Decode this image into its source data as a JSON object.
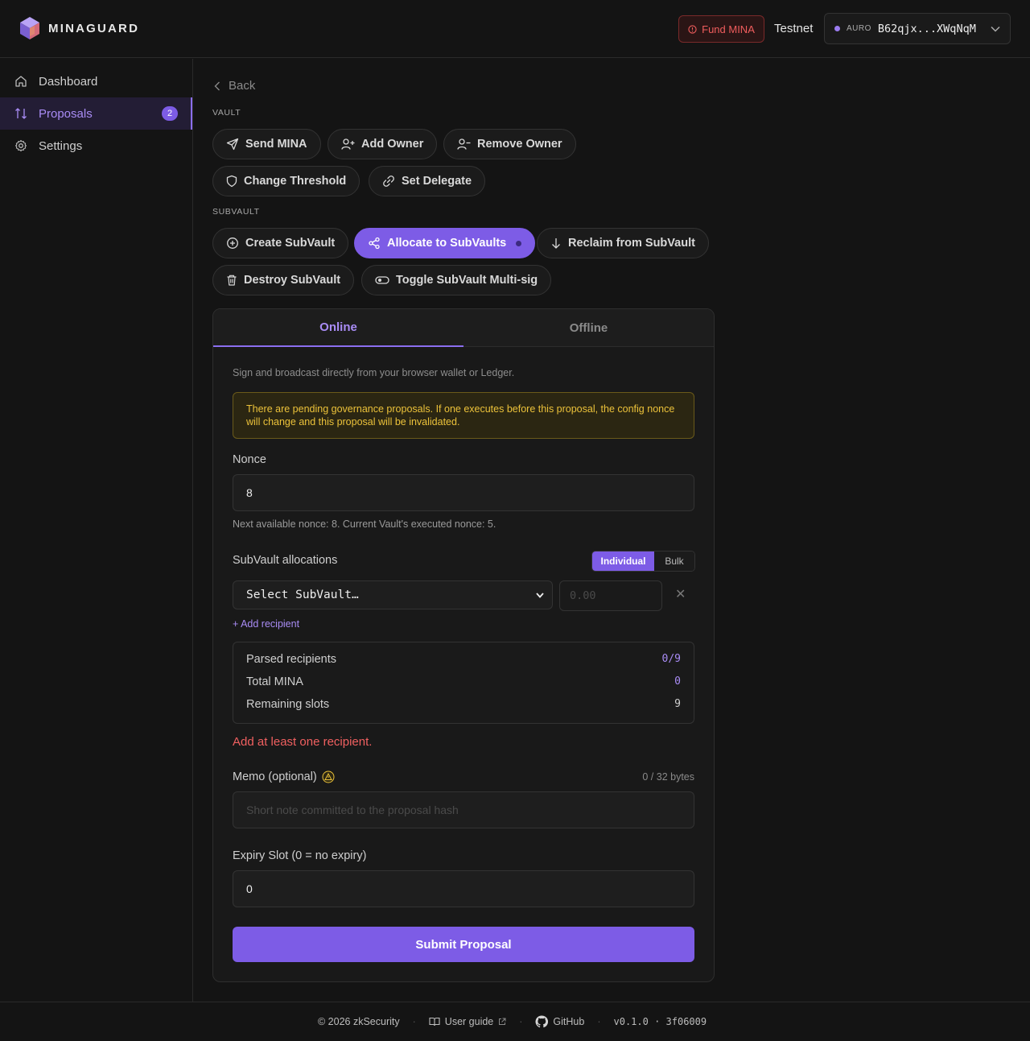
{
  "app": {
    "name": "MINAGUARD"
  },
  "header": {
    "fund_label": "Fund MINA",
    "network": "Testnet",
    "wallet_label": "AURO",
    "wallet_address": "B62qjx...XWqNqM"
  },
  "sidebar": {
    "items": [
      {
        "label": "Dashboard"
      },
      {
        "label": "Proposals",
        "badge": "2"
      },
      {
        "label": "Settings"
      }
    ]
  },
  "main": {
    "back_label": "Back",
    "vault_section": "VAULT",
    "vault_actions": [
      "Send MINA",
      "Add Owner",
      "Remove Owner",
      "Change Threshold",
      "Set Delegate"
    ],
    "subvault_section": "SUBVAULT",
    "subvault_actions": [
      "Create SubVault",
      "Allocate to SubVaults",
      "Reclaim from SubVault",
      "Destroy SubVault",
      "Toggle SubVault Multi-sig"
    ],
    "tabs": [
      "Online",
      "Offline"
    ],
    "description": "Sign and broadcast directly from your browser wallet or Ledger.",
    "warning_line1": "There are pending governance proposals. If one executes before this proposal, the config nonce",
    "warning_line2": "will change and this proposal will be invalidated.",
    "nonce_label": "Nonce",
    "nonce_value": "8",
    "nonce_hint": "Next available nonce: 8. Current Vault's executed nonce: 5.",
    "allocations_label": "SubVault allocations",
    "mode_options": [
      "Individual",
      "Bulk"
    ],
    "subvault_select": "Select SubVault…",
    "amount_placeholder": "0.00",
    "add_recipient": "+ Add recipient",
    "summary": {
      "parsed_label": "Parsed recipients",
      "parsed_value": "0/9",
      "total_label": "Total MINA",
      "total_value": "0",
      "remaining_label": "Remaining slots",
      "remaining_value": "9"
    },
    "error": "Add at least one recipient.",
    "memo_label": "Memo (optional)",
    "memo_bytes": "0 / 32 bytes",
    "memo_placeholder": "Short note committed to the proposal hash",
    "expiry_label": "Expiry Slot (0 = no expiry)",
    "expiry_value": "0",
    "submit_label": "Submit Proposal"
  },
  "footer": {
    "copyright": "© 2026 zkSecurity",
    "guide": "User guide",
    "github": "GitHub",
    "version": "v0.1.0 · 3f06009"
  },
  "colors": {
    "accent": "#7d5ce6",
    "warning": "#ecc23a",
    "error": "#f06060"
  }
}
